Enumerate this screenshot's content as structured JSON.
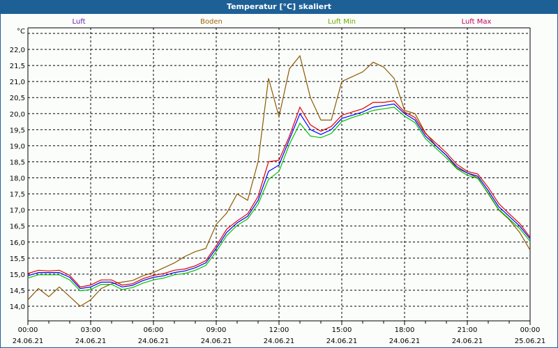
{
  "window": {
    "title": "Temperatur [°C] skaliert"
  },
  "chart_data": {
    "type": "line",
    "title": "Temperatur [°C] skaliert",
    "ylabel": "°C",
    "xlabel": "",
    "ylim": [
      13.4,
      22.6
    ],
    "xlim_hours": [
      0,
      24
    ],
    "grid": true,
    "y_ticks": [
      "14,0",
      "14,5",
      "15,0",
      "15,5",
      "16,0",
      "16,5",
      "17,0",
      "17,5",
      "18,0",
      "18,5",
      "19,0",
      "19,5",
      "20,0",
      "20,5",
      "21,0",
      "21,5",
      "22,0"
    ],
    "y_tick_values": [
      14,
      14.5,
      15,
      15.5,
      16,
      16.5,
      17,
      17.5,
      18,
      18.5,
      19,
      19.5,
      20,
      20.5,
      21,
      21.5,
      22
    ],
    "x_ticks": [
      {
        "hour": 0,
        "time": "00:00",
        "date": "24.06.21"
      },
      {
        "hour": 3,
        "time": "03:00",
        "date": "24.06.21"
      },
      {
        "hour": 6,
        "time": "06:00",
        "date": "24.06.21"
      },
      {
        "hour": 9,
        "time": "09:00",
        "date": "24.06.21"
      },
      {
        "hour": 12,
        "time": "12:00",
        "date": "24.06.21"
      },
      {
        "hour": 15,
        "time": "15:00",
        "date": "24.06.21"
      },
      {
        "hour": 18,
        "time": "18:00",
        "date": "24.06.21"
      },
      {
        "hour": 21,
        "time": "21:00",
        "date": "24.06.21"
      },
      {
        "hour": 24,
        "time": "00:00",
        "date": "25.06.21"
      }
    ],
    "legend_placement": "top",
    "x": [
      0,
      0.5,
      1,
      1.5,
      2,
      2.5,
      3,
      3.5,
      4,
      4.5,
      5,
      5.5,
      6,
      6.5,
      7,
      7.5,
      8,
      8.5,
      9,
      9.5,
      10,
      10.5,
      11,
      11.5,
      12,
      12.5,
      13,
      13.5,
      14,
      14.5,
      15,
      15.5,
      16,
      16.5,
      17,
      17.5,
      18,
      18.5,
      19,
      19.5,
      20,
      20.5,
      21,
      21.5,
      22,
      22.5,
      23,
      23.5,
      24
    ],
    "series": [
      {
        "name": "Luft",
        "color": "#0000ff",
        "legend_color": "#6a1fb0",
        "values": [
          14.95,
          15.05,
          15.05,
          15.05,
          14.9,
          14.55,
          14.6,
          14.75,
          14.75,
          14.6,
          14.65,
          14.8,
          14.9,
          14.95,
          15.05,
          15.1,
          15.2,
          15.35,
          15.8,
          16.3,
          16.6,
          16.8,
          17.3,
          18.2,
          18.4,
          19.2,
          20.0,
          19.5,
          19.35,
          19.5,
          19.85,
          19.95,
          20.05,
          20.2,
          20.25,
          20.3,
          20.0,
          19.8,
          19.3,
          19.0,
          18.7,
          18.35,
          18.15,
          18.05,
          17.6,
          17.1,
          16.8,
          16.5,
          16.1
        ]
      },
      {
        "name": "Boden",
        "color": "#8b5a00",
        "legend_color": "#a0620a",
        "values": [
          14.2,
          14.55,
          14.3,
          14.6,
          14.3,
          14.0,
          14.2,
          14.55,
          14.7,
          14.75,
          14.8,
          14.95,
          15.05,
          15.2,
          15.35,
          15.55,
          15.7,
          15.8,
          16.55,
          16.9,
          17.5,
          17.3,
          18.5,
          21.1,
          19.9,
          21.4,
          21.8,
          20.5,
          19.8,
          19.8,
          21.0,
          21.15,
          21.3,
          21.6,
          21.45,
          21.1,
          20.1,
          20.0,
          19.4,
          19.0,
          18.7,
          18.3,
          18.15,
          18.0,
          17.5,
          17.0,
          16.7,
          16.3,
          15.75
        ]
      },
      {
        "name": "Luft Min",
        "color": "#00c000",
        "legend_color": "#6fa800",
        "values": [
          14.88,
          14.98,
          14.98,
          14.98,
          14.82,
          14.48,
          14.52,
          14.68,
          14.68,
          14.52,
          14.58,
          14.72,
          14.82,
          14.88,
          14.98,
          15.02,
          15.12,
          15.27,
          15.7,
          16.2,
          16.52,
          16.72,
          17.18,
          17.95,
          18.2,
          19.05,
          19.7,
          19.3,
          19.25,
          19.38,
          19.75,
          19.88,
          19.98,
          20.1,
          20.15,
          20.2,
          19.92,
          19.72,
          19.22,
          18.92,
          18.62,
          18.28,
          18.08,
          17.98,
          17.52,
          17.02,
          16.72,
          16.42,
          16.02
        ]
      },
      {
        "name": "Luft Max",
        "color": "#e00000",
        "legend_color": "#c0005a",
        "values": [
          15.02,
          15.12,
          15.1,
          15.12,
          14.96,
          14.6,
          14.66,
          14.82,
          14.82,
          14.66,
          14.7,
          14.86,
          14.96,
          15.02,
          15.12,
          15.16,
          15.26,
          15.42,
          15.88,
          16.4,
          16.66,
          16.88,
          17.42,
          18.5,
          18.55,
          19.3,
          20.2,
          19.65,
          19.45,
          19.6,
          19.95,
          20.05,
          20.15,
          20.35,
          20.35,
          20.4,
          20.05,
          19.88,
          19.38,
          19.08,
          18.78,
          18.42,
          18.2,
          18.12,
          17.7,
          17.2,
          16.88,
          16.58,
          16.15
        ]
      }
    ]
  }
}
